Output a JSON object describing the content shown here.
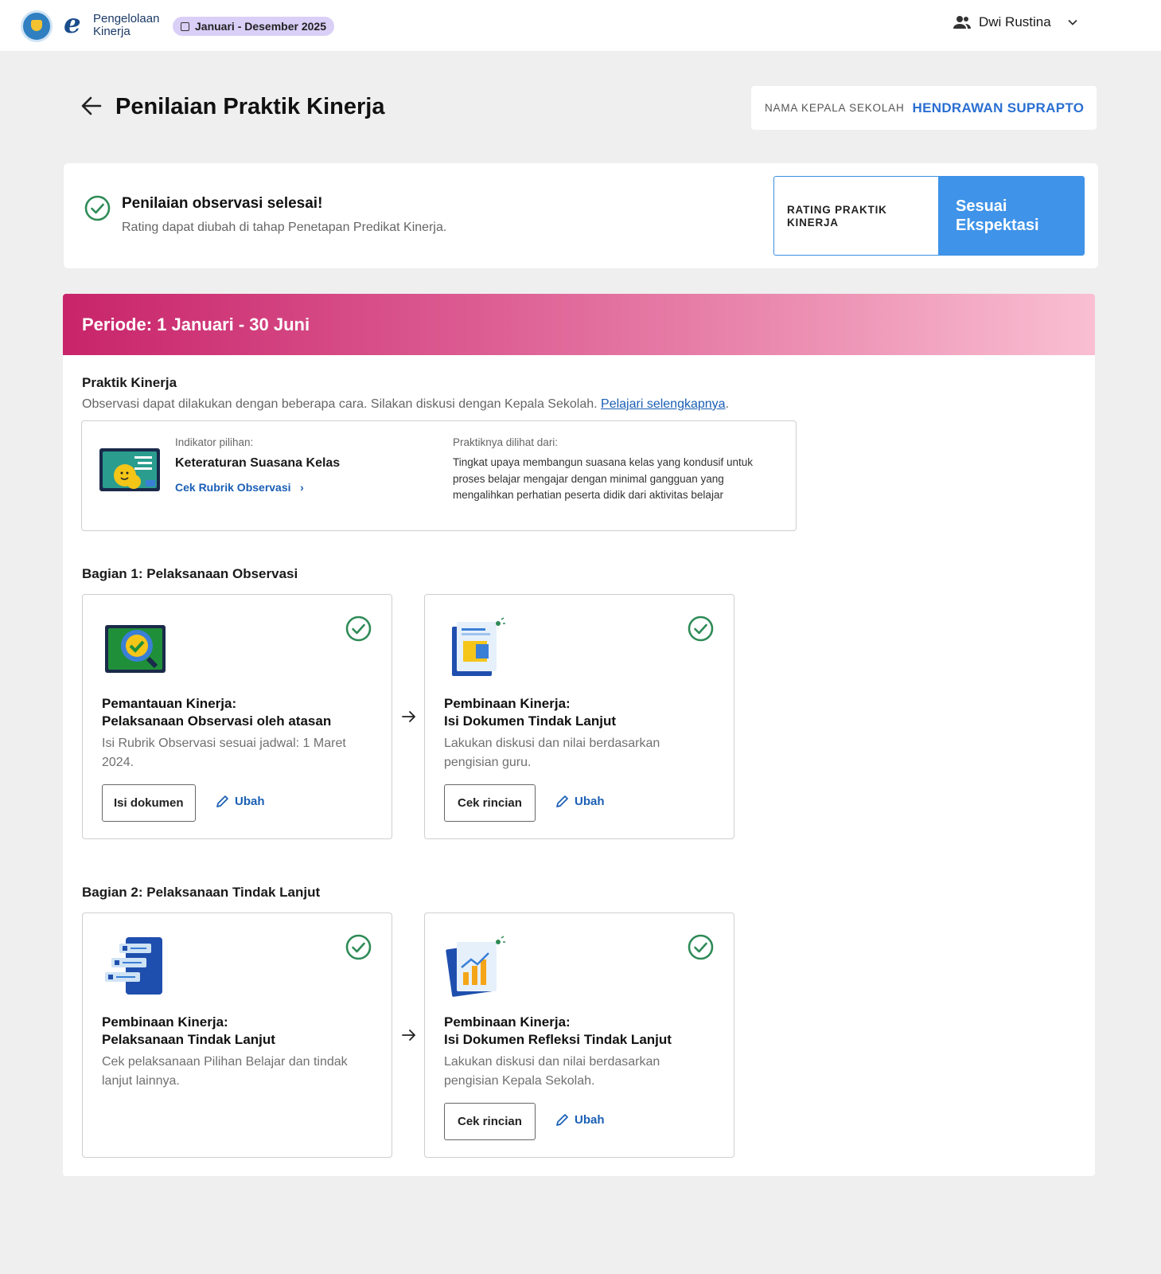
{
  "header": {
    "brand_line1": "Pengelolaan",
    "brand_line2": "Kinerja",
    "period": "Januari - Desember 2025",
    "user_name": "Dwi Rustina"
  },
  "page": {
    "title": "Penilaian Praktik Kinerja",
    "principal_label": "NAMA KEPALA SEKOLAH",
    "principal_name": "HENDRAWAN SUPRAPTO"
  },
  "status": {
    "title": "Penilaian observasi selesai!",
    "subtitle": "Rating dapat diubah di tahap Penetapan Predikat Kinerja.",
    "rating_label": "RATING PRAKTIK KINERJA",
    "rating_value": "Sesuai Ekspektasi"
  },
  "period_banner": "Periode: 1 Januari - 30 Juni",
  "praktik": {
    "title": "Praktik Kinerja",
    "desc": "Observasi dapat dilakukan dengan beberapa cara. Silakan diskusi dengan Kepala Sekolah.",
    "link": "Pelajari selengkapnya",
    "indicator_label": "Indikator pilihan:",
    "indicator_name": "Keteraturan Suasana Kelas",
    "rubric_link": "Cek Rubrik Observasi",
    "seen_label": "Praktiknya dilihat dari:",
    "seen_text": "Tingkat upaya membangun suasana kelas yang kondusif untuk proses belajar mengajar dengan minimal gangguan yang mengalihkan perhatian peserta didik dari aktivitas belajar"
  },
  "bagian1": {
    "title": "Bagian 1: Pelaksanaan Observasi",
    "cards": [
      {
        "title1": "Pemantauan Kinerja:",
        "title2": "Pelaksanaan Observasi oleh atasan",
        "desc": "Isi Rubrik Observasi sesuai jadwal: 1 Maret 2024.",
        "button": "Isi dokumen",
        "edit": "Ubah"
      },
      {
        "title1": "Pembinaan Kinerja:",
        "title2": "Isi Dokumen Tindak Lanjut",
        "desc": "Lakukan diskusi dan nilai berdasarkan pengisian guru.",
        "button": "Cek rincian",
        "edit": "Ubah"
      }
    ]
  },
  "bagian2": {
    "title": "Bagian 2: Pelaksanaan Tindak Lanjut",
    "cards": [
      {
        "title1": "Pembinaan Kinerja:",
        "title2": "Pelaksanaan Tindak Lanjut",
        "desc": "Cek pelaksanaan Pilihan Belajar dan tindak lanjut lainnya."
      },
      {
        "title1": "Pembinaan Kinerja:",
        "title2": "Isi Dokumen Refleksi Tindak Lanjut",
        "desc": "Lakukan diskusi dan nilai berdasarkan pengisian Kepala Sekolah.",
        "button": "Cek rincian",
        "edit": "Ubah"
      }
    ]
  },
  "colors": {
    "accent_blue": "#3f93e8",
    "link_blue": "#1a5fb5",
    "success_green": "#2e8b57",
    "banner_start": "#c8246a",
    "banner_end": "#f9bfd2"
  }
}
